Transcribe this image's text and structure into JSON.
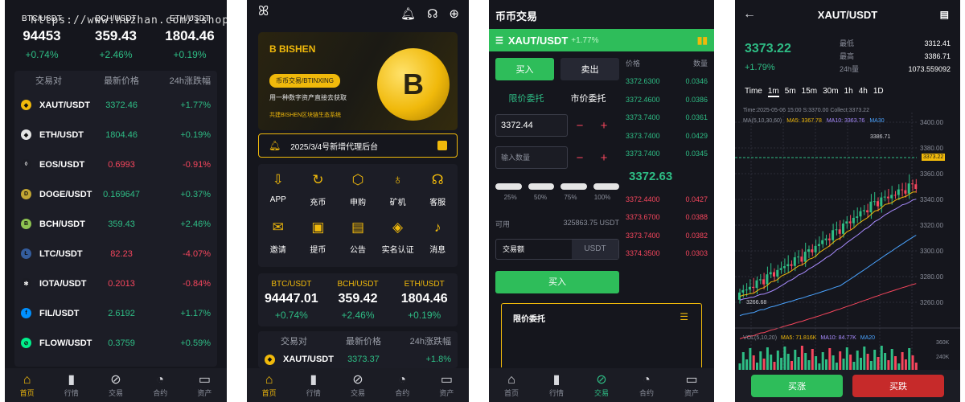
{
  "watermark": "https://www.huzhan.com/ishop6110",
  "p1": {
    "tickers": [
      {
        "symbol": "BTC/USDT",
        "price": "94453",
        "change": "+0.74%"
      },
      {
        "symbol": "BCH/USDT",
        "price": "359.43",
        "change": "+2.46%"
      },
      {
        "symbol": "ETH/USDT",
        "price": "1804.46",
        "change": "+0.19%"
      }
    ],
    "market_headers": [
      "交易对",
      "最新价格",
      "24h涨跌幅"
    ],
    "market": [
      {
        "pair": "XAUT/USDT",
        "price": "3372.46",
        "change": "+1.77%",
        "dir": "up",
        "color": "#f0b90b",
        "glyph": "◆"
      },
      {
        "pair": "ETH/USDT",
        "price": "1804.46",
        "change": "+0.19%",
        "dir": "up",
        "color": "#e5e5e5",
        "glyph": "◆"
      },
      {
        "pair": "EOS/USDT",
        "price": "0.6993",
        "change": "-0.91%",
        "dir": "down",
        "color": "#1b1c24",
        "glyph": "◊"
      },
      {
        "pair": "DOGE/USDT",
        "price": "0.169647",
        "change": "+0.37%",
        "dir": "up",
        "color": "#c2a633",
        "glyph": "D"
      },
      {
        "pair": "BCH/USDT",
        "price": "359.43",
        "change": "+2.46%",
        "dir": "up",
        "color": "#8dc351",
        "glyph": "B"
      },
      {
        "pair": "LTC/USDT",
        "price": "82.23",
        "change": "-4.07%",
        "dir": "down",
        "color": "#345d9d",
        "glyph": "Ł"
      },
      {
        "pair": "IOTA/USDT",
        "price": "0.2013",
        "change": "-0.84%",
        "dir": "down",
        "color": "#1b1c24",
        "glyph": "✻"
      },
      {
        "pair": "FIL/USDT",
        "price": "2.6192",
        "change": "+1.17%",
        "dir": "up",
        "color": "#0090ff",
        "glyph": "f"
      },
      {
        "pair": "FLOW/USDT",
        "price": "0.3759",
        "change": "+0.59%",
        "dir": "up",
        "color": "#00ef8b",
        "glyph": "⊘"
      }
    ]
  },
  "nav": [
    {
      "label": "首页",
      "icon": "home-icon",
      "glyph": "⌂"
    },
    {
      "label": "行情",
      "icon": "bar-chart-icon",
      "glyph": "▮"
    },
    {
      "label": "交易",
      "icon": "exchange-icon",
      "glyph": "⊘"
    },
    {
      "label": "合约",
      "icon": "trend-icon",
      "glyph": "◔"
    },
    {
      "label": "资产",
      "icon": "wallet-icon",
      "glyph": "▭"
    }
  ],
  "p2": {
    "banner": {
      "brand": "BISHEN",
      "pill": "币币交易/BTINXING",
      "line1": "用一种数字资产直接去获取",
      "line2": "共建BISHEN区块链生态系统"
    },
    "notice": "2025/3/4号新增代理后台",
    "grid": [
      {
        "label": "APP",
        "icon": "download-icon",
        "glyph": "⇩"
      },
      {
        "label": "充币",
        "icon": "deposit-icon",
        "glyph": "↻"
      },
      {
        "label": "申购",
        "icon": "cube-icon",
        "glyph": "⬡"
      },
      {
        "label": "矿机",
        "icon": "mining-icon",
        "glyph": "♁"
      },
      {
        "label": "客服",
        "icon": "headset-icon",
        "glyph": "☊"
      },
      {
        "label": "邀请",
        "icon": "invite-icon",
        "glyph": "✉"
      },
      {
        "label": "提币",
        "icon": "withdraw-icon",
        "glyph": "▣"
      },
      {
        "label": "公告",
        "icon": "announcement-icon",
        "glyph": "▤"
      },
      {
        "label": "实名认证",
        "icon": "verify-icon",
        "glyph": "◈"
      },
      {
        "label": "消息",
        "icon": "bell-icon",
        "glyph": "♪"
      }
    ],
    "tickers": [
      {
        "symbol": "BTC/USDT",
        "price": "94447.01",
        "change": "+0.74%"
      },
      {
        "symbol": "BCH/USDT",
        "price": "359.42",
        "change": "+2.46%"
      },
      {
        "symbol": "ETH/USDT",
        "price": "1804.46",
        "change": "+0.19%"
      }
    ],
    "market_headers": [
      "交易对",
      "最新价格",
      "24h涨跌幅"
    ],
    "market": [
      {
        "pair": "XAUT/USDT",
        "price": "3373.37",
        "change": "+1.8%"
      }
    ]
  },
  "p3": {
    "title": "币币交易",
    "pair": "XAUT/USDT",
    "pair_change": "+1.77%",
    "buy": "买入",
    "sell": "卖出",
    "limit_order": "限价委托",
    "market_order": "市价委托",
    "price_value": "3372.44",
    "qty_placeholder": "输入数量",
    "pcts": [
      "25%",
      "50%",
      "75%",
      "100%"
    ],
    "avail_label": "可用",
    "avail_value": "325863.75 USDT",
    "amount_label": "交易额",
    "amount_unit": "USDT",
    "buy_button": "买入",
    "ob_headers": [
      "价格",
      "数量"
    ],
    "bids": [
      [
        "3372.6300",
        "0.0346"
      ],
      [
        "3372.4600",
        "0.0386"
      ],
      [
        "3373.7400",
        "0.0361"
      ],
      [
        "3373.7400",
        "0.0429"
      ],
      [
        "3373.7400",
        "0.0345"
      ]
    ],
    "mid_price": "3372.63",
    "asks": [
      [
        "3372.4400",
        "0.0427"
      ],
      [
        "3373.6700",
        "0.0388"
      ],
      [
        "3373.7400",
        "0.0382"
      ],
      [
        "3374.3500",
        "0.0303"
      ]
    ],
    "limit_panel_title": "限价委托"
  },
  "p4": {
    "title": "XAUT/USDT",
    "price": "3373.22",
    "change": "+1.79%",
    "stats": [
      {
        "k": "最低",
        "v": "3312.41"
      },
      {
        "k": "最高",
        "v": "3386.71"
      },
      {
        "k": "24h量",
        "v": "1073.559092"
      }
    ],
    "timeframes": [
      "Time",
      "1m",
      "5m",
      "15m",
      "30m",
      "1h",
      "4h",
      "1D"
    ],
    "info": "Time:2025-05-06 15:00   S:3370.00   Collect:3373.22",
    "ma_labels": [
      "MA(5,10,30,60)",
      "MA5: 3367.78",
      "MA10: 3363.76",
      "MA30"
    ],
    "y_ticks": [
      "3400.00",
      "3380.00",
      "3360.00",
      "3340.00",
      "3320.00",
      "3300.00",
      "3280.00",
      "3260.00"
    ],
    "high_marker": "3386.71",
    "low_marker": "3266.68",
    "last_tag": "3373.22",
    "vol_labels": [
      "VOL(5,10,20)",
      "MA5: 71.816K",
      "MA10: 84.77K",
      "MA20"
    ],
    "vol_ticks": [
      "360K",
      "240K"
    ],
    "rise": "买涨",
    "fall": "买跌",
    "up_color": "#2ebd85",
    "down_color": "#f6465d"
  }
}
